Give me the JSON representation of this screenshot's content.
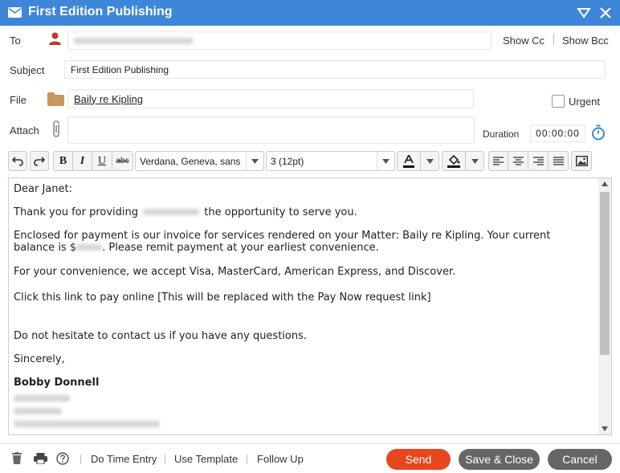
{
  "window": {
    "title": "First Edition Publishing"
  },
  "to": {
    "label": "To",
    "value_redacted": "lawbets@examplefirm.com"
  },
  "cc_link": "Show Cc",
  "bcc_link": "Show Bcc",
  "subject": {
    "label": "Subject",
    "value": "First Edition Publishing"
  },
  "file": {
    "label": "File",
    "value": "Baily re Kipling"
  },
  "urgent": {
    "label": "Urgent",
    "checked": false
  },
  "attach": {
    "label": "Attach",
    "value": ""
  },
  "duration": {
    "label": "Duration",
    "value": "00:00:00"
  },
  "toolbar": {
    "bold": "B",
    "italic": "I",
    "underline": "U",
    "strike": "abc",
    "font": "Verdana, Geneva, sans",
    "size": "3 (12pt)"
  },
  "body": {
    "greeting": "Dear Janet:",
    "line1_pre": "Thank you for providing",
    "line1_post": "the opportunity to serve you.",
    "line2a": "Enclosed for payment is our invoice for services rendered on your Matter: Baily re Kipling.  Your current",
    "line2b_pre": "balance is $",
    "line2b_post": ". Please remit payment at your earliest convenience.",
    "line3": "For your convenience, we accept Visa, MasterCard, American Express, and Discover.",
    "line4": "Click this link to pay online [This will be replaced with the Pay Now request link]",
    "line5": "Do not hesitate to contact us if you have any questions.",
    "closing": "Sincerely,",
    "signature": "Bobby Donnell"
  },
  "footer": {
    "time_entry": "Do Time Entry",
    "template": "Use Template",
    "follow_up": "Follow Up",
    "send": "Send",
    "save_close": "Save & Close",
    "cancel": "Cancel"
  },
  "colors": {
    "title_bar": "#3d86d8",
    "send": "#e8461e",
    "secondary_button": "#666666",
    "duration_icon": "#3d86d8",
    "folder": "#c9955a",
    "user_icon": "#c0392b"
  }
}
